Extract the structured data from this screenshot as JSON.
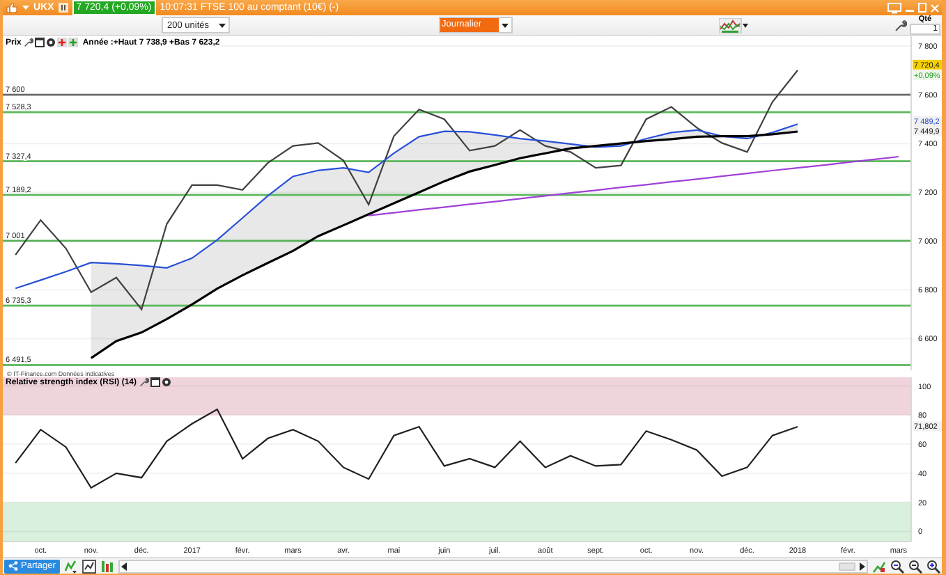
{
  "window": {
    "symbol": "UKX",
    "quote": "7 720,4 (+0,09%)",
    "title": "10:07:31 FTSE 100 au comptant (10€) (-)"
  },
  "toolbar": {
    "units": "200 unités",
    "period": "Journalier",
    "quantity_label": "Qté",
    "quantity": "1"
  },
  "price_pane": {
    "legend_title": "Prix",
    "legend_text": "Année :+Haut 7 738,9 +Bas 7 623,2",
    "copyright": "© IT-Finance.com Données indicatives",
    "chart_data": {
      "type": "line",
      "categories": [
        null,
        null,
        null,
        null,
        null,
        null,
        null,
        null,
        null,
        null,
        null,
        null,
        null,
        null,
        null,
        null,
        null,
        null,
        null,
        null,
        null,
        null,
        null,
        null,
        null,
        null,
        null,
        null,
        null,
        null,
        null,
        null,
        null,
        null,
        null,
        null
      ],
      "series": [
        {
          "color": "#404040",
          "values": [
            6943,
            7086,
            6970,
            6790,
            6850,
            6720,
            7070,
            7230,
            7230,
            7210,
            7320,
            7390,
            7402,
            7330,
            7150,
            7430,
            7540,
            7500,
            7371,
            7390,
            7455,
            7390,
            7365,
            7300,
            7310,
            7500,
            7550,
            7465,
            7402,
            7365,
            7570,
            7700,
            null,
            null,
            null,
            null
          ]
        },
        {
          "color": "#2850d8",
          "values": [
            6806,
            6840,
            6875,
            6912,
            6907,
            6900,
            6890,
            6930,
            7005,
            7095,
            7185,
            7265,
            7290,
            7300,
            7282,
            7360,
            7428,
            7450,
            7448,
            7435,
            7420,
            7410,
            7398,
            7385,
            7390,
            7420,
            7445,
            7455,
            7430,
            7420,
            7445,
            7480,
            null,
            null,
            null,
            null
          ]
        },
        {
          "color": "#000000",
          "values": [
            null,
            null,
            null,
            6520,
            6590,
            6625,
            6680,
            6740,
            6805,
            6860,
            6910,
            6960,
            7020,
            7065,
            7110,
            7155,
            7200,
            7245,
            7285,
            7312,
            7340,
            7360,
            7380,
            7390,
            7400,
            7410,
            7418,
            7428,
            7430,
            7430,
            7438,
            7449,
            null,
            null,
            null,
            null
          ]
        },
        {
          "color": "#a040d8",
          "values": [
            null,
            null,
            null,
            null,
            null,
            null,
            null,
            null,
            null,
            null,
            null,
            null,
            null,
            null,
            7105,
            7116,
            7128,
            7139,
            7151,
            7162,
            7174,
            7185,
            7197,
            7208,
            7220,
            7231,
            7243,
            7254,
            7266,
            7277,
            7289,
            7300,
            7311,
            7323,
            7334,
            7346
          ]
        }
      ],
      "ylim": [
        6470,
        7840
      ],
      "grid": true,
      "yticks": [
        {
          "value": 7800,
          "label": "7 800"
        },
        {
          "value": 7600,
          "label": "7 600"
        },
        {
          "value": 7400,
          "label": "7 400"
        },
        {
          "value": 7200,
          "label": "7 200"
        },
        {
          "value": 7000,
          "label": "7 000"
        },
        {
          "value": 6800,
          "label": "6 800"
        },
        {
          "value": 6600,
          "label": "6 600"
        }
      ]
    },
    "levels": [
      {
        "label": "7 600",
        "color": "#707070"
      },
      {
        "label": "7 528,3",
        "color": "#5cb85c"
      },
      {
        "label": "7 327,4",
        "color": "#5cb85c"
      },
      {
        "label": "7 189,2",
        "color": "#5cb85c"
      },
      {
        "label": "7 001",
        "color": "#5cb85c"
      },
      {
        "label": "6 735,3",
        "color": "#5cb85c"
      },
      {
        "label": "6 491,5",
        "color": "#5cb85c"
      }
    ],
    "axis_tags": [
      {
        "label": "7 720,4",
        "change": "+0,09%",
        "color": "#202020",
        "highlighted": true
      },
      {
        "label": "7 489,2",
        "color": "#2850d8",
        "highlighted": false
      },
      {
        "label": "7 449,9",
        "color": "#202020",
        "highlighted": false
      }
    ]
  },
  "rsi_pane": {
    "legend_title": "Relative strength index (RSI) (14)",
    "chart_data": {
      "type": "line",
      "categories": [
        null,
        "oct.",
        null,
        "nov.",
        null,
        "déc.",
        null,
        "2017",
        null,
        "févr.",
        null,
        "mars",
        null,
        "avr.",
        null,
        "mai",
        null,
        "juin",
        null,
        "juil.",
        null,
        "août",
        null,
        "sept.",
        null,
        "oct.",
        null,
        "nov.",
        null,
        "déc.",
        null,
        "2018",
        null,
        "févr.",
        null,
        "mars"
      ],
      "series": [
        {
          "color": "#202020",
          "values": [
            47,
            70,
            58,
            30,
            40,
            37,
            62,
            74,
            84,
            50,
            64,
            70,
            62,
            44,
            36,
            66,
            72,
            45,
            50,
            44,
            62,
            44,
            52,
            45,
            46,
            69,
            63,
            56,
            38,
            44,
            66,
            72,
            null,
            null,
            null,
            null
          ]
        }
      ],
      "ylim": [
        -7,
        106
      ],
      "grid": true,
      "yticks": [
        {
          "value": 0,
          "label": "0"
        },
        {
          "value": 20,
          "label": "20"
        },
        {
          "value": 40,
          "label": "40"
        },
        {
          "value": 60,
          "label": "60"
        },
        {
          "value": 80,
          "label": "80"
        },
        {
          "value": 100,
          "label": "100"
        }
      ]
    },
    "upper_band": {
      "color": "#f0d4dc"
    },
    "lower_band": {
      "color": "#d9f0dc"
    },
    "axis_tag": {
      "label": "71,802"
    }
  },
  "bottom_bar": {
    "share_button": "Partager"
  }
}
